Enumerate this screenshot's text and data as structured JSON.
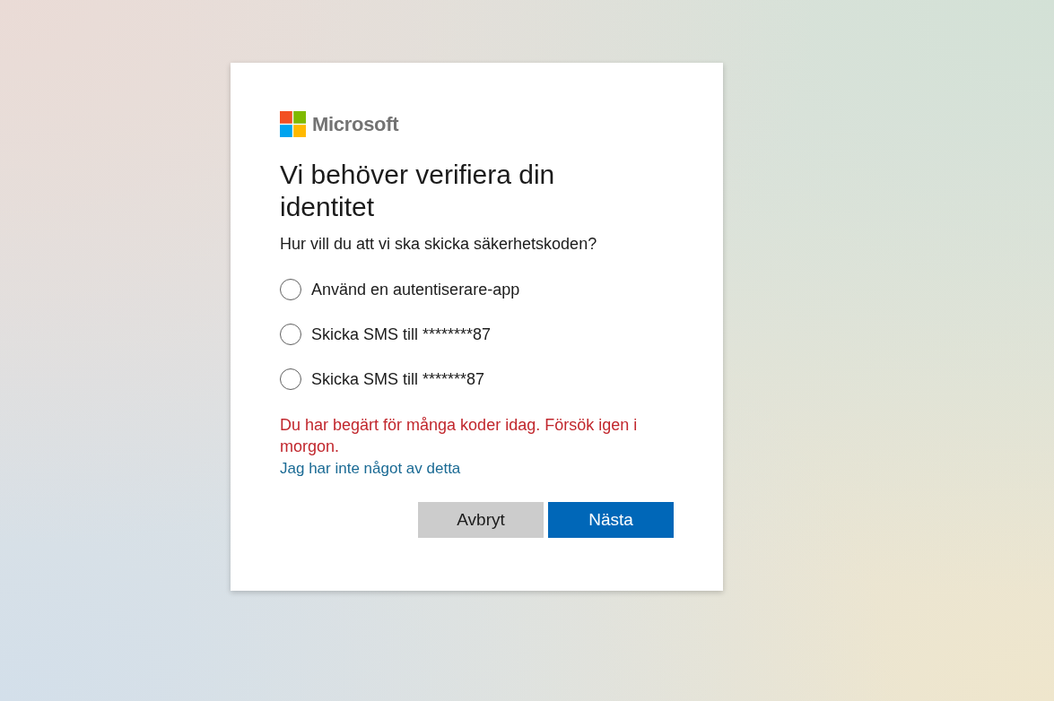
{
  "logo": {
    "text": "Microsoft"
  },
  "title": "Vi behöver verifiera din identitet",
  "prompt": "Hur vill du att vi ska skicka säkerhetskoden?",
  "options": [
    {
      "label": "Använd en autentiserare-app",
      "selected": false
    },
    {
      "label": "Skicka SMS till ********87",
      "selected": false
    },
    {
      "label": "Skicka SMS till *******87",
      "selected": false
    }
  ],
  "error": "Du har begärt för många koder idag. Försök igen i morgon.",
  "link": "Jag har inte något av detta",
  "buttons": [
    {
      "label": "Avbryt",
      "kind": "secondary"
    },
    {
      "label": "Nästa",
      "kind": "primary"
    }
  ]
}
